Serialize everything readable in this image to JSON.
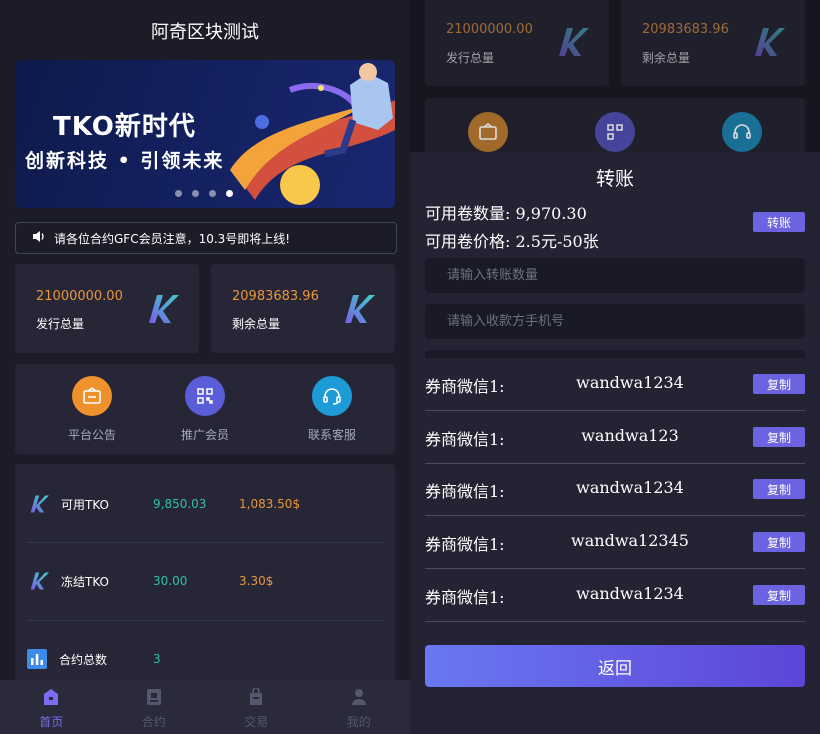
{
  "left": {
    "title": "阿奇区块测试",
    "banner": {
      "headline": "TKO新时代",
      "tagline": "创新科技 • 引领未来",
      "slide_count": 4,
      "active_slide": 4
    },
    "notice": "请各位合约GFC会员注意，10.3号即将上线!",
    "stats": [
      {
        "value": "21000000.00",
        "label": "发行总量"
      },
      {
        "value": "20983683.96",
        "label": "剩余总量"
      }
    ],
    "menu": [
      {
        "label": "平台公告",
        "icon": "announcement-icon",
        "color": "#f0922c"
      },
      {
        "label": "推广会员",
        "icon": "qrcode-icon",
        "color": "#5b5cd8"
      },
      {
        "label": "联系客服",
        "icon": "headset-icon",
        "color": "#1c9bd6"
      }
    ],
    "assets": [
      {
        "name": "可用TKO",
        "amount": "9,850.03",
        "value": "1,083.50$"
      },
      {
        "name": "冻结TKO",
        "amount": "30.00",
        "value": "3.30$"
      },
      {
        "name": "合约总数",
        "amount": "3",
        "value": ""
      }
    ],
    "tabs": [
      {
        "label": "首页",
        "icon": "home-icon",
        "active": true
      },
      {
        "label": "合约",
        "icon": "contract-icon",
        "active": false
      },
      {
        "label": "交易",
        "icon": "trade-icon",
        "active": false
      },
      {
        "label": "我的",
        "icon": "user-icon",
        "active": false
      }
    ]
  },
  "right": {
    "stats": [
      {
        "value": "21000000.00",
        "label": "发行总量"
      },
      {
        "value": "20983683.96",
        "label": "剩余总量"
      }
    ],
    "modal": {
      "title": "转账",
      "available_label": "可用卷数量:",
      "available_value": "9,970.30",
      "price_label": "可用卷价格:",
      "price_value": "2.5元-50张",
      "transfer_button": "转账",
      "amount_placeholder": "请输入转账数量",
      "phone_placeholder": "请输入收款方手机号",
      "wechat_rows": [
        {
          "label": "券商微信1:",
          "value": "wandwa1234",
          "button": "复制"
        },
        {
          "label": "券商微信1:",
          "value": "wandwa123",
          "button": "复制"
        },
        {
          "label": "券商微信1:",
          "value": "wandwa1234",
          "button": "复制"
        },
        {
          "label": "券商微信1:",
          "value": "wandwa12345",
          "button": "复制"
        },
        {
          "label": "券商微信1:",
          "value": "wandwa1234",
          "button": "复制"
        }
      ],
      "back_button": "返回"
    }
  }
}
